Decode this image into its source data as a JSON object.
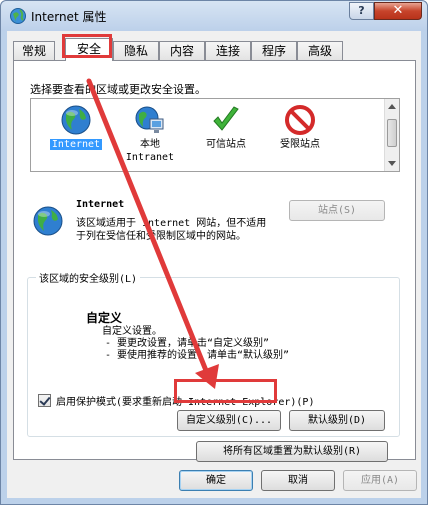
{
  "window": {
    "title": "Internet 属性",
    "help_label": "?",
    "close_label": "✕"
  },
  "tabs": [
    {
      "label": "常规",
      "active": false
    },
    {
      "label": "安全",
      "active": true
    },
    {
      "label": "隐私",
      "active": false
    },
    {
      "label": "内容",
      "active": false
    },
    {
      "label": "连接",
      "active": false
    },
    {
      "label": "程序",
      "active": false
    },
    {
      "label": "高级",
      "active": false
    }
  ],
  "security": {
    "zone_caption": "选择要查看的区域或更改安全设置。",
    "zones": [
      {
        "label": "Internet",
        "icon": "globe-icon",
        "selected": true
      },
      {
        "label": "本地\nIntranet",
        "icon": "local-intranet-icon",
        "selected": false
      },
      {
        "label": "可信站点",
        "icon": "green-check-icon",
        "selected": false
      },
      {
        "label": "受限站点",
        "icon": "no-entry-icon",
        "selected": false
      }
    ],
    "zone_info": {
      "name": "Internet",
      "description": "该区域适用于 Internet 网站，但不适用于列在受信任和受限制区域中的网站。",
      "sites_button": "站点(S)"
    },
    "level_group_title": "该区域的安全级别(L)",
    "level": {
      "name": "自定义",
      "lines": [
        "自定义设置。",
        "- 要更改设置，请单击“自定义级别”",
        "- 要使用推荐的设置，请单击“默认级别”"
      ]
    },
    "protected_mode": {
      "label": "启用保护模式(要求重新启动 Internet Explorer)(P)",
      "checked": true
    },
    "custom_level_button": "自定义级别(C)...",
    "default_level_button": "默认级别(D)",
    "reset_all_button": "将所有区域重置为默认级别(R)"
  },
  "footer": {
    "ok": "确定",
    "cancel": "取消",
    "apply": "应用(A)"
  },
  "colors": {
    "highlight_red": "#e03a3a",
    "selection_blue": "#3399ff"
  }
}
